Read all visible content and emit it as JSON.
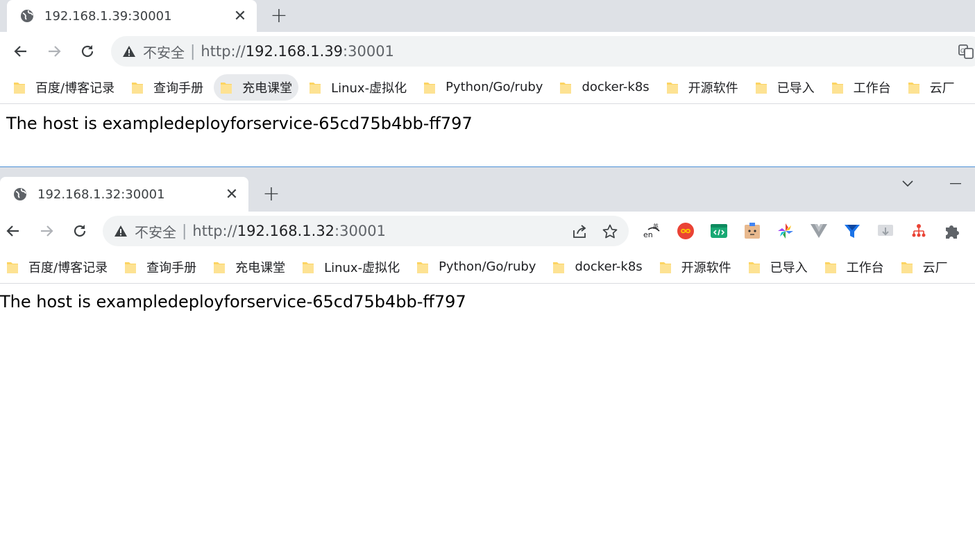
{
  "window1": {
    "tab": {
      "title": "192.168.1.39:30001",
      "close_glyph": "✕"
    },
    "new_tab_glyph": "+",
    "omnibox": {
      "insecure_label": "不安全",
      "separator": "|",
      "url_protocol": "http://",
      "url_host": "192.168.1.39",
      "url_port": ":30001"
    },
    "page_text": "The host is exampledeployforservice-65cd75b4bb-ff797"
  },
  "window2": {
    "tab": {
      "title": "192.168.1.32:30001",
      "close_glyph": "✕"
    },
    "new_tab_glyph": "+",
    "omnibox": {
      "insecure_label": "不安全",
      "separator": "|",
      "url_protocol": "http://",
      "url_host": "192.168.1.32",
      "url_port": ":30001"
    },
    "page_text": "The host is exampledeployforservice-65cd75b4bb-ff797"
  },
  "bookmarks": [
    {
      "label": "百度/博客记录"
    },
    {
      "label": "查询手册"
    },
    {
      "label": "充电课堂"
    },
    {
      "label": "Linux-虚拟化"
    },
    {
      "label": "Python/Go/ruby"
    },
    {
      "label": "docker-k8s"
    },
    {
      "label": "开源软件"
    },
    {
      "label": "已导入"
    },
    {
      "label": "工作台"
    },
    {
      "label": "云厂"
    }
  ],
  "extension_icons": [
    "translate-en-icon",
    "infinity-icon",
    "code-editor-icon",
    "cartoon-face-icon",
    "pinwheel-icon",
    "vue-devtools-icon",
    "funnel-icon",
    "download-tray-icon",
    "sitemap-icon",
    "puzzle-extensions-icon"
  ],
  "colors": {
    "tab_strip": "#dee1e6",
    "omnibox_bg": "#f1f3f4",
    "folder_yellow": "#fcd462",
    "window_border_blue": "#4a8fd6"
  }
}
